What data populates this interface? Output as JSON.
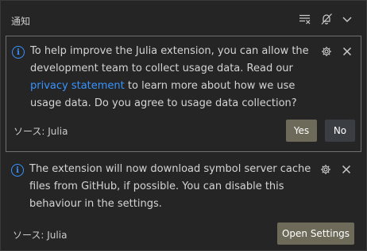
{
  "header": {
    "title": "通知",
    "icons": [
      "clear-all-icon",
      "do-not-disturb-icon",
      "chevron-down-icon"
    ]
  },
  "notifications": [
    {
      "icon": "info-icon",
      "message_part1": "To help improve the Julia extension, you can allow the development team to collect usage data. Read our ",
      "link_text": "privacy statement",
      "message_part2": " to learn more about how we use usage data. Do you agree to usage data collection?",
      "source": "ソース: Julia",
      "buttons": [
        {
          "label": "Yes",
          "style": "primary"
        },
        {
          "label": "No",
          "style": "secondary"
        }
      ]
    },
    {
      "icon": "info-icon",
      "message": "The extension will now download symbol server cache files from GitHub, if possible. You can disable this behaviour in the settings.",
      "source": "ソース: Julia",
      "buttons": [
        {
          "label": "Open Settings",
          "style": "primary"
        }
      ]
    }
  ],
  "colors": {
    "background": "#252526",
    "link": "#3794ff",
    "primary_button": "#6e6a5a",
    "secondary_button": "#3a3d41",
    "focus_border": "#707070"
  }
}
